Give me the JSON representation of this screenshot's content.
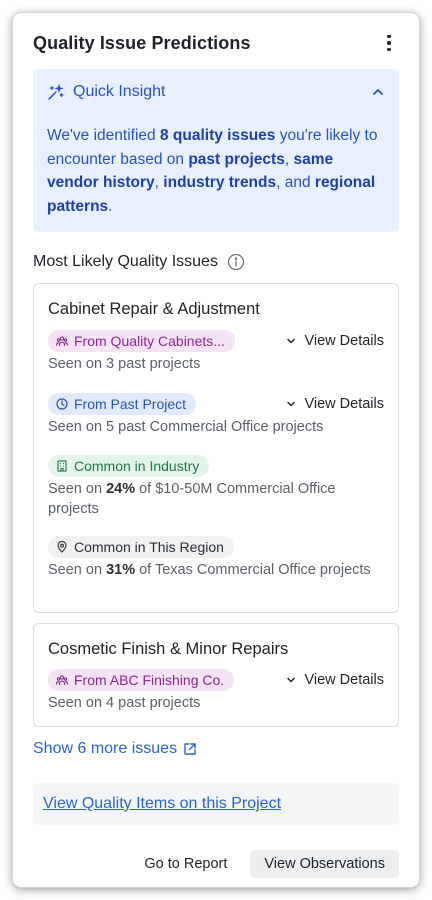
{
  "header": {
    "title": "Quality Issue Predictions",
    "menu_icon": "kebab-menu-icon"
  },
  "insight": {
    "title": "Quick Insight",
    "icon": "sparkle-icon",
    "collapse_icon": "chevron-up-icon",
    "text_1": "We've identified ",
    "bold_1": "8 quality issues",
    "text_2": " you're likely to encounter based on ",
    "bold_2": "past projects",
    "text_3": ", ",
    "bold_3": "same vendor history",
    "text_4": ", ",
    "bold_4": "industry trends",
    "text_5": ", and ",
    "bold_5": "regional patterns",
    "text_6": "."
  },
  "section": {
    "title": "Most Likely Quality Issues",
    "info_icon": "info-icon"
  },
  "issues": [
    {
      "title": "Cabinet Repair & Adjustment",
      "sources": [
        {
          "tag": "From Quality Cabinets...",
          "tag_icon": "people-group-icon",
          "tag_color": "#f6e3f6",
          "details_label": "View Details",
          "seen_prefix": "Seen on 3 past projects"
        },
        {
          "tag": "From Past Project",
          "tag_icon": "clock-icon",
          "tag_color": "#e2eaff",
          "details_label": "View Details",
          "seen_prefix": "Seen on 5 past Commercial Office projects"
        },
        {
          "tag": "Common in Industry",
          "tag_icon": "building-icon",
          "tag_color": "#e3f5ea",
          "seen_prefix": "Seen on ",
          "seen_bold": "24%",
          "seen_suffix": " of $10-50M Commercial Office projects"
        },
        {
          "tag": "Common in This Region",
          "tag_icon": "location-pin-icon",
          "tag_color": "#f0f1f2",
          "seen_prefix": "Seen on ",
          "seen_bold": "31%",
          "seen_suffix": " of Texas Commercial Office projects"
        }
      ]
    },
    {
      "title": "Cosmetic Finish & Minor Repairs",
      "sources": [
        {
          "tag": "From ABC Finishing Co.",
          "tag_icon": "people-group-icon",
          "tag_color": "#f6e3f6",
          "details_label": "View Details",
          "seen_prefix": "Seen on 4 past projects"
        }
      ]
    }
  ],
  "show_more": {
    "label": "Show 6 more issues",
    "icon": "external-link-icon"
  },
  "quality_link": "View Quality Items on this Project",
  "footer": {
    "report_button": "Go to Report",
    "observations_button": "View Observations"
  },
  "colors": {
    "accent": "#2a52be",
    "link": "#2a63d6",
    "insight_bg": "#e8efff"
  }
}
